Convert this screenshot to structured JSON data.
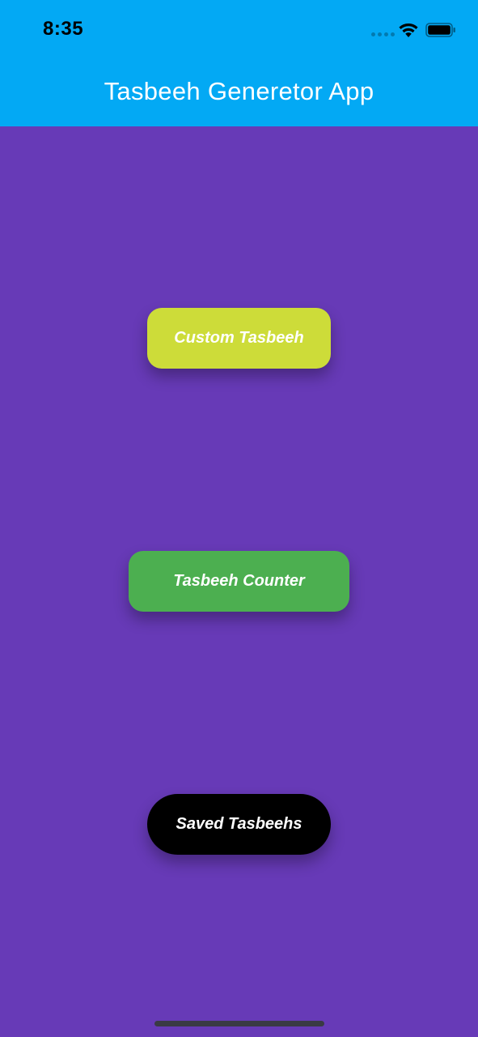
{
  "status_bar": {
    "time": "8:35",
    "icons": [
      "signal-dots-icon",
      "wifi-icon",
      "battery-icon"
    ]
  },
  "app_bar": {
    "title": "Tasbeeh Generetor App",
    "background": "#03a9f4"
  },
  "body": {
    "background": "#673ab7"
  },
  "buttons": {
    "custom": {
      "label": "Custom Tasbeeh",
      "color": "#cddc39"
    },
    "counter": {
      "label": "Tasbeeh Counter",
      "color": "#4caf50"
    },
    "saved": {
      "label": "Saved Tasbeehs",
      "color": "#000000"
    }
  }
}
